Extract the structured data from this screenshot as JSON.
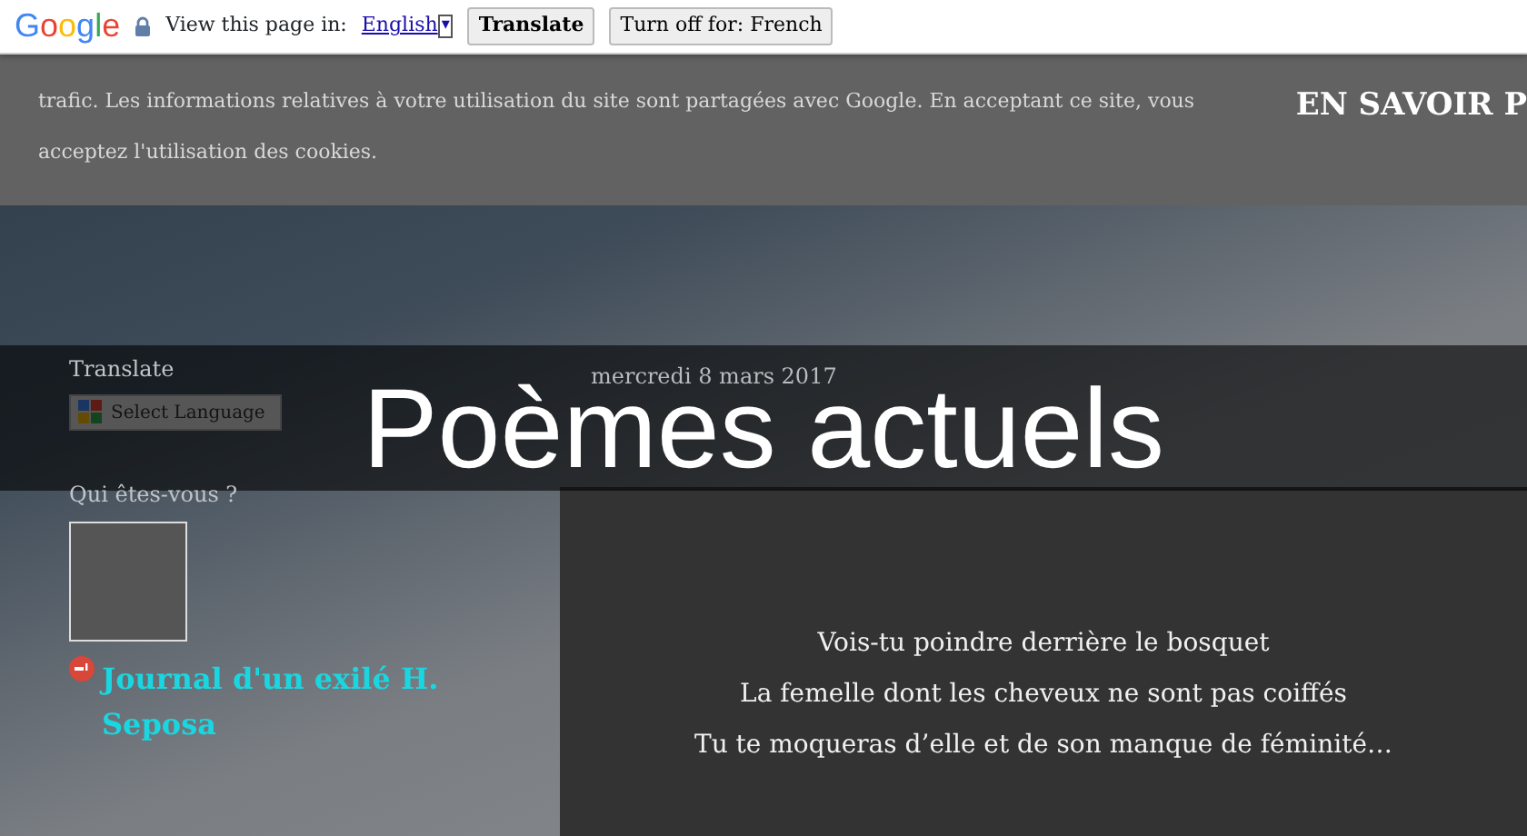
{
  "translate_bar": {
    "logo": "Google",
    "prompt": "View this page in:",
    "language": "English",
    "dropdown_arrow": "▾",
    "buttons": [
      "Translate",
      "Turn off for: French"
    ]
  },
  "cookie_banner": {
    "text_lines": [
      "trafic. Les informations relatives à votre utilisation du site sont partagées avec Google. En acceptant ce site, vous",
      "acceptez l'utilisation des cookies."
    ],
    "link": "EN SAVOIR P"
  },
  "sidebar": {
    "translate_heading": "Translate",
    "language_select": "Select Language",
    "profile_heading": "Qui êtes-vous ?",
    "profile_name": "Journal d'un exilé H. Seposa"
  },
  "post": {
    "date": "mercredi 8 mars 2017",
    "lines": [
      "Vois-tu poindre derrière le bosquet",
      "La femelle dont les cheveux ne sont pas coiffés",
      "Tu te moqueras d’elle et de son manque de féminité…"
    ]
  },
  "overlay_title": "Poèmes actuels"
}
